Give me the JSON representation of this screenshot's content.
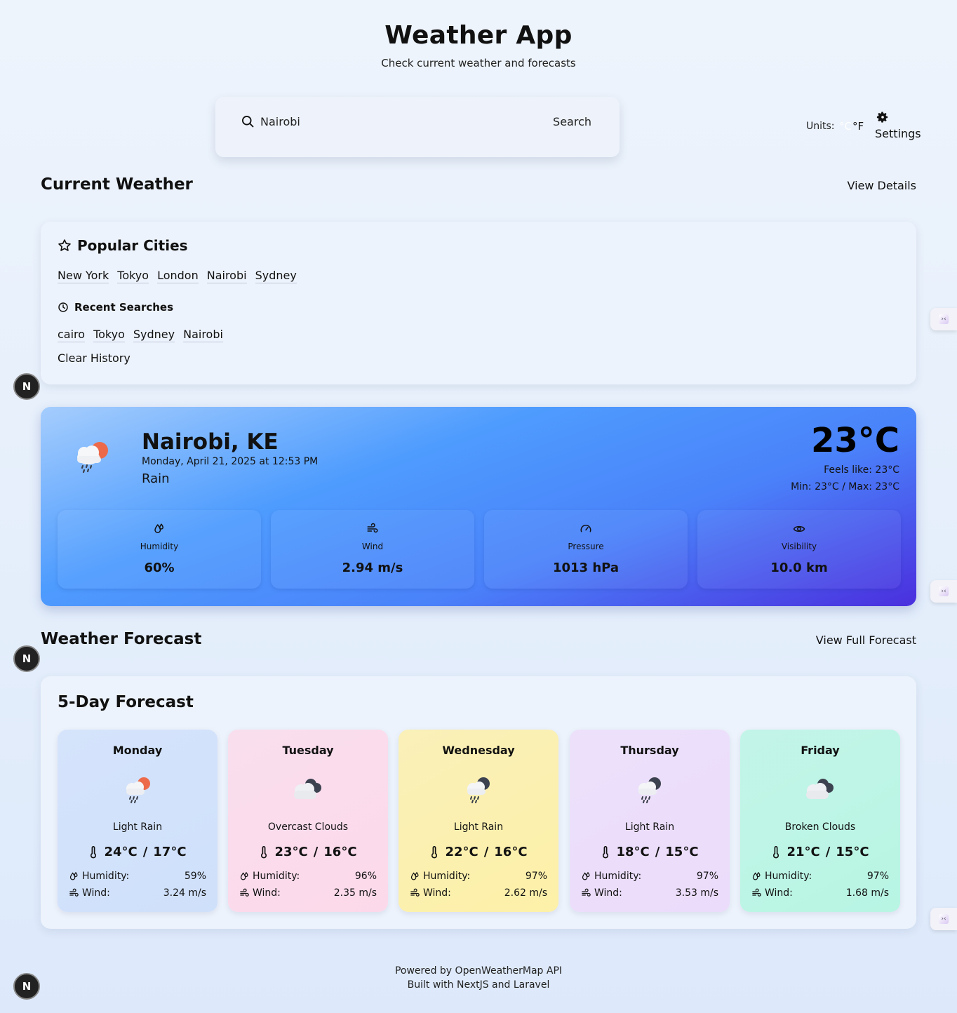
{
  "header": {
    "title": "Weather App",
    "subtitle": "Check current weather and forecasts"
  },
  "search": {
    "value": "Nairobi",
    "button_label": "Search",
    "icon": "search-icon"
  },
  "units": {
    "label": "Units:",
    "celsius": "°C",
    "fahrenheit": "°F",
    "selected": "°C"
  },
  "settings": {
    "label": "Settings",
    "icon": "gear-icon"
  },
  "current_section": {
    "title": "Current Weather",
    "link": "View Details"
  },
  "popular_cities": {
    "title": "Popular Cities",
    "icon": "star-icon",
    "cities": [
      "New York",
      "Tokyo",
      "London",
      "Nairobi",
      "Sydney"
    ]
  },
  "recent_searches": {
    "title": "Recent Searches",
    "icon": "clock-icon",
    "items": [
      "cairo",
      "Tokyo",
      "Sydney",
      "Nairobi"
    ],
    "clear_label": "Clear History"
  },
  "current_weather": {
    "city": "Nairobi, KE",
    "datetime": "Monday, April 21, 2025 at 12:53 PM",
    "description": "Rain",
    "icon": "rain-sun-cloud-icon",
    "temperature": "23°C",
    "feels_like": "Feels like: 23°C",
    "min_max": "Min: 23°C / Max: 23°C",
    "metrics": [
      {
        "label": "Humidity",
        "value": "60%",
        "icon": "droplets-icon"
      },
      {
        "label": "Wind",
        "value": "2.94 m/s",
        "icon": "wind-icon"
      },
      {
        "label": "Pressure",
        "value": "1013 hPa",
        "icon": "gauge-icon"
      },
      {
        "label": "Visibility",
        "value": "10.0 km",
        "icon": "eye-icon"
      }
    ]
  },
  "forecast_section": {
    "title": "Weather Forecast",
    "link": "View Full Forecast"
  },
  "forecast": {
    "title": "5-Day Forecast",
    "humidity_label": "Humidity:",
    "wind_label": "Wind:",
    "temp_separator": "/",
    "days": [
      {
        "day": "Monday",
        "description": "Light Rain",
        "high": "24°C",
        "low": "17°C",
        "humidity": "59%",
        "wind": "3.24 m/s",
        "icon": "rain-sun-cloud-icon",
        "bg": "#cfe0fb"
      },
      {
        "day": "Tuesday",
        "description": "Overcast Clouds",
        "high": "23°C",
        "low": "16°C",
        "humidity": "96%",
        "wind": "2.35 m/s",
        "icon": "overcast-clouds-icon",
        "bg": "#fcd9ea"
      },
      {
        "day": "Wednesday",
        "description": "Light Rain",
        "high": "22°C",
        "low": "16°C",
        "humidity": "97%",
        "wind": "2.62 m/s",
        "icon": "rain-night-cloud-icon",
        "bg": "#fdf0a8"
      },
      {
        "day": "Thursday",
        "description": "Light Rain",
        "high": "18°C",
        "low": "15°C",
        "humidity": "97%",
        "wind": "3.53 m/s",
        "icon": "rain-night-cloud-icon",
        "bg": "#ecdcfb"
      },
      {
        "day": "Friday",
        "description": "Broken Clouds",
        "high": "21°C",
        "low": "15°C",
        "humidity": "97%",
        "wind": "1.68 m/s",
        "icon": "broken-clouds-icon",
        "bg": "#b8f5e3"
      }
    ]
  },
  "footer": {
    "line1": "Powered by OpenWeatherMap API",
    "line2": "Built with NextJS and Laravel"
  },
  "dev_badge": "N"
}
